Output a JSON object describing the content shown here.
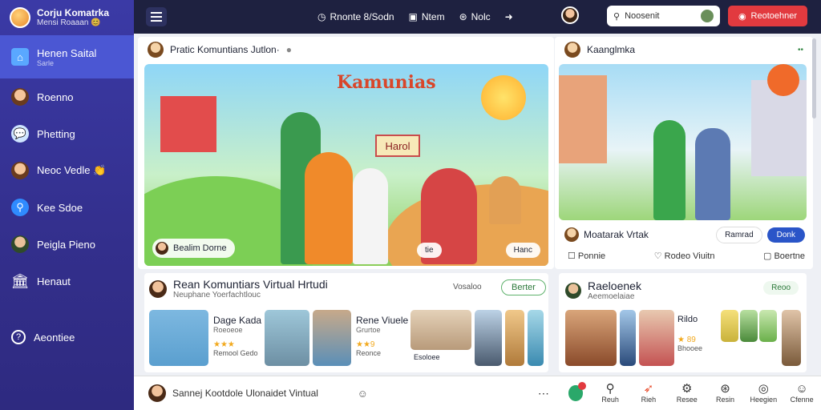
{
  "app": {
    "brand_line1": "Corju Komatrka",
    "brand_line2": "Mensi Roaaan 😊"
  },
  "sidebar": {
    "items": [
      {
        "label": "Henen Saital",
        "sub": "Sarle"
      },
      {
        "label": "Roenno",
        "sub": ""
      },
      {
        "label": "Phetting",
        "sub": ""
      },
      {
        "label": "Neoc Vedle 👏",
        "sub": ""
      },
      {
        "label": "Kee Sdoe",
        "sub": ""
      },
      {
        "label": "Peigla Pieno",
        "sub": ""
      },
      {
        "label": "Henaut",
        "sub": ""
      },
      {
        "label": "Aeontiee",
        "sub": ""
      }
    ]
  },
  "topbar": {
    "tabs": [
      "Rnonte 8/Sodn",
      "Ntem",
      "Nolc"
    ],
    "search_value": "Noosenit",
    "action_label": "Reotoehner"
  },
  "feed": {
    "header": "Pratic Komuntians Jutlon·",
    "hero_title": "Kamunias",
    "hero_sign": "Harol",
    "hero_badge": "Bealim Dorne",
    "hero_chip1": "tie",
    "hero_chip2": "Hanc"
  },
  "right_card": {
    "header": "Kaanglmka",
    "title": "Moatarak Vrtak",
    "btn_outline": "Ramrad",
    "btn_primary": "Donk",
    "action1": "Ponnie",
    "action2": "Rodeo Viuitn",
    "action3": "Boertne"
  },
  "community": {
    "title": "Rean Komuntiars Virtual Hrtudi",
    "subtitle": "Neuphane Yoerfachtlouc",
    "meta": "Vosaloo",
    "follow": "Berter",
    "cards": [
      {
        "name": "Dage Kada",
        "sub": "Roeoeoe",
        "rating": "★★★",
        "foot": "Remool Gedo"
      },
      {
        "name": "Rene Viuele",
        "sub": "Grurtoe",
        "rating": "★★9",
        "foot": "Reonce"
      },
      {
        "name": "Esoloee",
        "sub": "",
        "rating": "",
        "foot": ""
      }
    ]
  },
  "right_community": {
    "title": "Raeloenek",
    "subtitle": "Aeemoelaiae",
    "follow": "Reoo",
    "name": "Rildo",
    "rating": "★ 89",
    "foot": "Bhooee"
  },
  "composer": {
    "placeholder": "Sannej Kootdole Ulonaidet Vintual"
  },
  "bottom_nav": [
    "Reuh",
    "Rieh",
    "Resee",
    "Resin",
    "Heegien",
    "Cfenne"
  ]
}
